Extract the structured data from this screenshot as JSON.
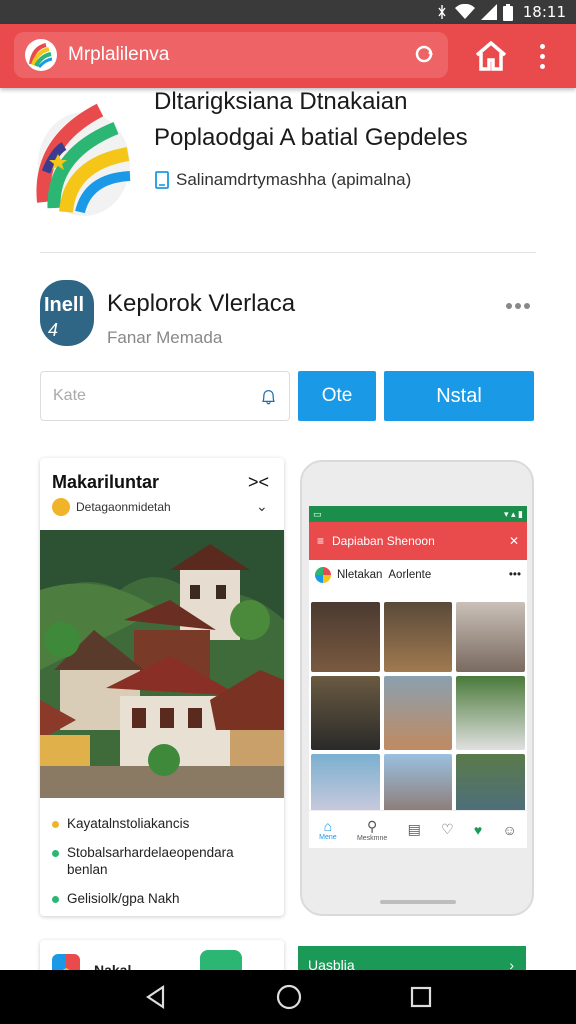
{
  "status_bar": {
    "time": "18:11"
  },
  "app_bar": {
    "url": "Mrplalilenva"
  },
  "hero": {
    "title": "Dltarigksiana Dtnakaian",
    "subtitle": "Poplaodgai  A batial Gepdeles",
    "meta": "Salinamdrtymashha (apimalna)"
  },
  "app": {
    "icon_text": "Inell",
    "icon_num": "4",
    "name": "Keplorok Vlerlaca",
    "developer": "Fanar Memada"
  },
  "search": {
    "placeholder": "Kate"
  },
  "buttons": {
    "open": "Ote",
    "install": "Nstal"
  },
  "card": {
    "title": "Makariluntar",
    "close": "><",
    "developer": "Detagaonmidetah",
    "bullets": [
      {
        "text": "Kayatalnstoliakancis",
        "color": "#f0b429"
      },
      {
        "text": "Stobalsarhardelaeopendara benlan",
        "color": "#2bb673"
      },
      {
        "text": "Gelisiolk/gpa Nakh",
        "color": "#2bb673"
      }
    ]
  },
  "phone": {
    "appbar_title": "Dapiaban Shenoon",
    "row_a": "Nletakan",
    "row_b": "Aorlente",
    "nav": [
      "Mene",
      "Meskmne",
      "",
      "",
      "",
      ""
    ]
  },
  "bottom": {
    "card_title": "Nakal",
    "green_label": "Uasblia"
  },
  "colors": {
    "accent_red": "#e94a4c",
    "accent_blue": "#1a9ae6",
    "accent_green": "#1a9a56"
  }
}
